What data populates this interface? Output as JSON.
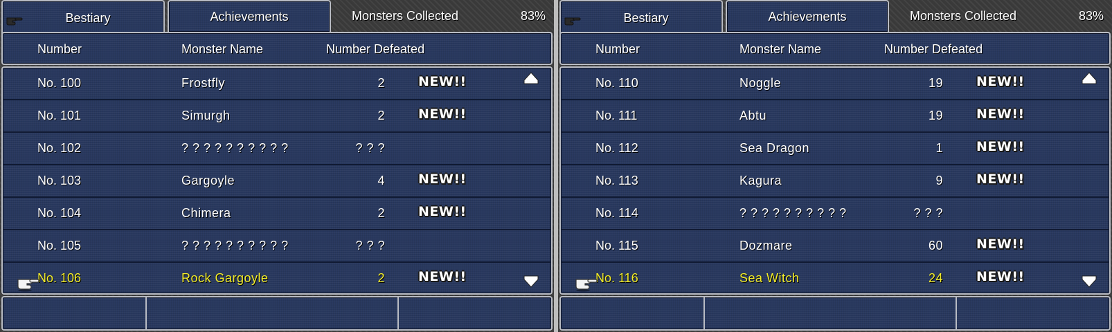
{
  "screens": [
    {
      "tabs": {
        "bestiary": "Bestiary",
        "achievements": "Achievements"
      },
      "collected": {
        "label": "Monsters Collected",
        "percent": "83%"
      },
      "headers": {
        "number": "Number",
        "name": "Monster Name",
        "defeated": "Number Defeated"
      },
      "rows": [
        {
          "number": "No. 100",
          "name": "Frostfly",
          "defeated": "2",
          "badge": "NEW!!",
          "selected": false
        },
        {
          "number": "No. 101",
          "name": "Simurgh",
          "defeated": "2",
          "badge": "NEW!!",
          "selected": false
        },
        {
          "number": "No. 102",
          "name": "? ? ? ? ? ? ? ? ? ?",
          "defeated": "? ? ?",
          "badge": "",
          "selected": false
        },
        {
          "number": "No. 103",
          "name": "Gargoyle",
          "defeated": "4",
          "badge": "NEW!!",
          "selected": false
        },
        {
          "number": "No. 104",
          "name": "Chimera",
          "defeated": "2",
          "badge": "NEW!!",
          "selected": false
        },
        {
          "number": "No. 105",
          "name": "? ? ? ? ? ? ? ? ? ?",
          "defeated": "? ? ?",
          "badge": "",
          "selected": false
        },
        {
          "number": "No. 106",
          "name": "Rock Gargoyle",
          "defeated": "2",
          "badge": "NEW!!",
          "selected": true
        }
      ]
    },
    {
      "tabs": {
        "bestiary": "Bestiary",
        "achievements": "Achievements"
      },
      "collected": {
        "label": "Monsters Collected",
        "percent": "83%"
      },
      "headers": {
        "number": "Number",
        "name": "Monster Name",
        "defeated": "Number Defeated"
      },
      "rows": [
        {
          "number": "No. 110",
          "name": "Noggle",
          "defeated": "19",
          "badge": "NEW!!",
          "selected": false
        },
        {
          "number": "No. 111",
          "name": "Abtu",
          "defeated": "19",
          "badge": "NEW!!",
          "selected": false
        },
        {
          "number": "No. 112",
          "name": "Sea Dragon",
          "defeated": "1",
          "badge": "NEW!!",
          "selected": false
        },
        {
          "number": "No. 113",
          "name": "Kagura",
          "defeated": "9",
          "badge": "NEW!!",
          "selected": false
        },
        {
          "number": "No. 114",
          "name": "? ? ? ? ? ? ? ? ? ?",
          "defeated": "? ? ?",
          "badge": "",
          "selected": false
        },
        {
          "number": "No. 115",
          "name": "Dozmare",
          "defeated": "60",
          "badge": "NEW!!",
          "selected": false
        },
        {
          "number": "No. 116",
          "name": "Sea Witch",
          "defeated": "24",
          "badge": "NEW!!",
          "selected": true
        }
      ]
    }
  ],
  "icons": {
    "tab_hand": "pointing-hand-icon",
    "cursor": "pointing-hand-cursor-icon",
    "scroll_up": "triangle-up-icon",
    "scroll_down": "triangle-down-icon"
  },
  "colors": {
    "panel": "#28385e",
    "border": "#b9bcc4",
    "selected_text": "#f2ec2a",
    "text": "#ffffff"
  }
}
